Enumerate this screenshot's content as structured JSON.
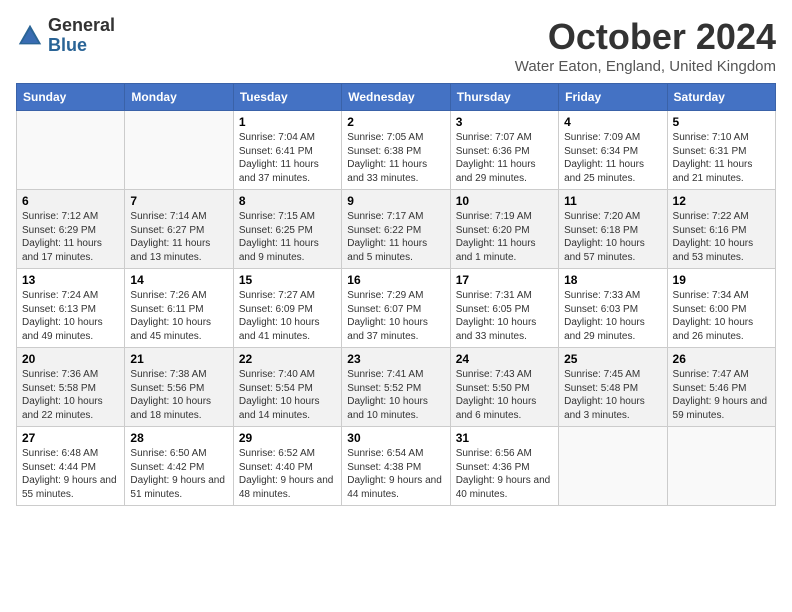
{
  "logo": {
    "general": "General",
    "blue": "Blue"
  },
  "title": "October 2024",
  "subtitle": "Water Eaton, England, United Kingdom",
  "days_of_week": [
    "Sunday",
    "Monday",
    "Tuesday",
    "Wednesday",
    "Thursday",
    "Friday",
    "Saturday"
  ],
  "weeks": [
    [
      {
        "day": "",
        "empty": true
      },
      {
        "day": "",
        "empty": true
      },
      {
        "day": "1",
        "sunrise": "Sunrise: 7:04 AM",
        "sunset": "Sunset: 6:41 PM",
        "daylight": "Daylight: 11 hours and 37 minutes."
      },
      {
        "day": "2",
        "sunrise": "Sunrise: 7:05 AM",
        "sunset": "Sunset: 6:38 PM",
        "daylight": "Daylight: 11 hours and 33 minutes."
      },
      {
        "day": "3",
        "sunrise": "Sunrise: 7:07 AM",
        "sunset": "Sunset: 6:36 PM",
        "daylight": "Daylight: 11 hours and 29 minutes."
      },
      {
        "day": "4",
        "sunrise": "Sunrise: 7:09 AM",
        "sunset": "Sunset: 6:34 PM",
        "daylight": "Daylight: 11 hours and 25 minutes."
      },
      {
        "day": "5",
        "sunrise": "Sunrise: 7:10 AM",
        "sunset": "Sunset: 6:31 PM",
        "daylight": "Daylight: 11 hours and 21 minutes."
      }
    ],
    [
      {
        "day": "6",
        "sunrise": "Sunrise: 7:12 AM",
        "sunset": "Sunset: 6:29 PM",
        "daylight": "Daylight: 11 hours and 17 minutes."
      },
      {
        "day": "7",
        "sunrise": "Sunrise: 7:14 AM",
        "sunset": "Sunset: 6:27 PM",
        "daylight": "Daylight: 11 hours and 13 minutes."
      },
      {
        "day": "8",
        "sunrise": "Sunrise: 7:15 AM",
        "sunset": "Sunset: 6:25 PM",
        "daylight": "Daylight: 11 hours and 9 minutes."
      },
      {
        "day": "9",
        "sunrise": "Sunrise: 7:17 AM",
        "sunset": "Sunset: 6:22 PM",
        "daylight": "Daylight: 11 hours and 5 minutes."
      },
      {
        "day": "10",
        "sunrise": "Sunrise: 7:19 AM",
        "sunset": "Sunset: 6:20 PM",
        "daylight": "Daylight: 11 hours and 1 minute."
      },
      {
        "day": "11",
        "sunrise": "Sunrise: 7:20 AM",
        "sunset": "Sunset: 6:18 PM",
        "daylight": "Daylight: 10 hours and 57 minutes."
      },
      {
        "day": "12",
        "sunrise": "Sunrise: 7:22 AM",
        "sunset": "Sunset: 6:16 PM",
        "daylight": "Daylight: 10 hours and 53 minutes."
      }
    ],
    [
      {
        "day": "13",
        "sunrise": "Sunrise: 7:24 AM",
        "sunset": "Sunset: 6:13 PM",
        "daylight": "Daylight: 10 hours and 49 minutes."
      },
      {
        "day": "14",
        "sunrise": "Sunrise: 7:26 AM",
        "sunset": "Sunset: 6:11 PM",
        "daylight": "Daylight: 10 hours and 45 minutes."
      },
      {
        "day": "15",
        "sunrise": "Sunrise: 7:27 AM",
        "sunset": "Sunset: 6:09 PM",
        "daylight": "Daylight: 10 hours and 41 minutes."
      },
      {
        "day": "16",
        "sunrise": "Sunrise: 7:29 AM",
        "sunset": "Sunset: 6:07 PM",
        "daylight": "Daylight: 10 hours and 37 minutes."
      },
      {
        "day": "17",
        "sunrise": "Sunrise: 7:31 AM",
        "sunset": "Sunset: 6:05 PM",
        "daylight": "Daylight: 10 hours and 33 minutes."
      },
      {
        "day": "18",
        "sunrise": "Sunrise: 7:33 AM",
        "sunset": "Sunset: 6:03 PM",
        "daylight": "Daylight: 10 hours and 29 minutes."
      },
      {
        "day": "19",
        "sunrise": "Sunrise: 7:34 AM",
        "sunset": "Sunset: 6:00 PM",
        "daylight": "Daylight: 10 hours and 26 minutes."
      }
    ],
    [
      {
        "day": "20",
        "sunrise": "Sunrise: 7:36 AM",
        "sunset": "Sunset: 5:58 PM",
        "daylight": "Daylight: 10 hours and 22 minutes."
      },
      {
        "day": "21",
        "sunrise": "Sunrise: 7:38 AM",
        "sunset": "Sunset: 5:56 PM",
        "daylight": "Daylight: 10 hours and 18 minutes."
      },
      {
        "day": "22",
        "sunrise": "Sunrise: 7:40 AM",
        "sunset": "Sunset: 5:54 PM",
        "daylight": "Daylight: 10 hours and 14 minutes."
      },
      {
        "day": "23",
        "sunrise": "Sunrise: 7:41 AM",
        "sunset": "Sunset: 5:52 PM",
        "daylight": "Daylight: 10 hours and 10 minutes."
      },
      {
        "day": "24",
        "sunrise": "Sunrise: 7:43 AM",
        "sunset": "Sunset: 5:50 PM",
        "daylight": "Daylight: 10 hours and 6 minutes."
      },
      {
        "day": "25",
        "sunrise": "Sunrise: 7:45 AM",
        "sunset": "Sunset: 5:48 PM",
        "daylight": "Daylight: 10 hours and 3 minutes."
      },
      {
        "day": "26",
        "sunrise": "Sunrise: 7:47 AM",
        "sunset": "Sunset: 5:46 PM",
        "daylight": "Daylight: 9 hours and 59 minutes."
      }
    ],
    [
      {
        "day": "27",
        "sunrise": "Sunrise: 6:48 AM",
        "sunset": "Sunset: 4:44 PM",
        "daylight": "Daylight: 9 hours and 55 minutes."
      },
      {
        "day": "28",
        "sunrise": "Sunrise: 6:50 AM",
        "sunset": "Sunset: 4:42 PM",
        "daylight": "Daylight: 9 hours and 51 minutes."
      },
      {
        "day": "29",
        "sunrise": "Sunrise: 6:52 AM",
        "sunset": "Sunset: 4:40 PM",
        "daylight": "Daylight: 9 hours and 48 minutes."
      },
      {
        "day": "30",
        "sunrise": "Sunrise: 6:54 AM",
        "sunset": "Sunset: 4:38 PM",
        "daylight": "Daylight: 9 hours and 44 minutes."
      },
      {
        "day": "31",
        "sunrise": "Sunrise: 6:56 AM",
        "sunset": "Sunset: 4:36 PM",
        "daylight": "Daylight: 9 hours and 40 minutes."
      },
      {
        "day": "",
        "empty": true
      },
      {
        "day": "",
        "empty": true
      }
    ]
  ]
}
